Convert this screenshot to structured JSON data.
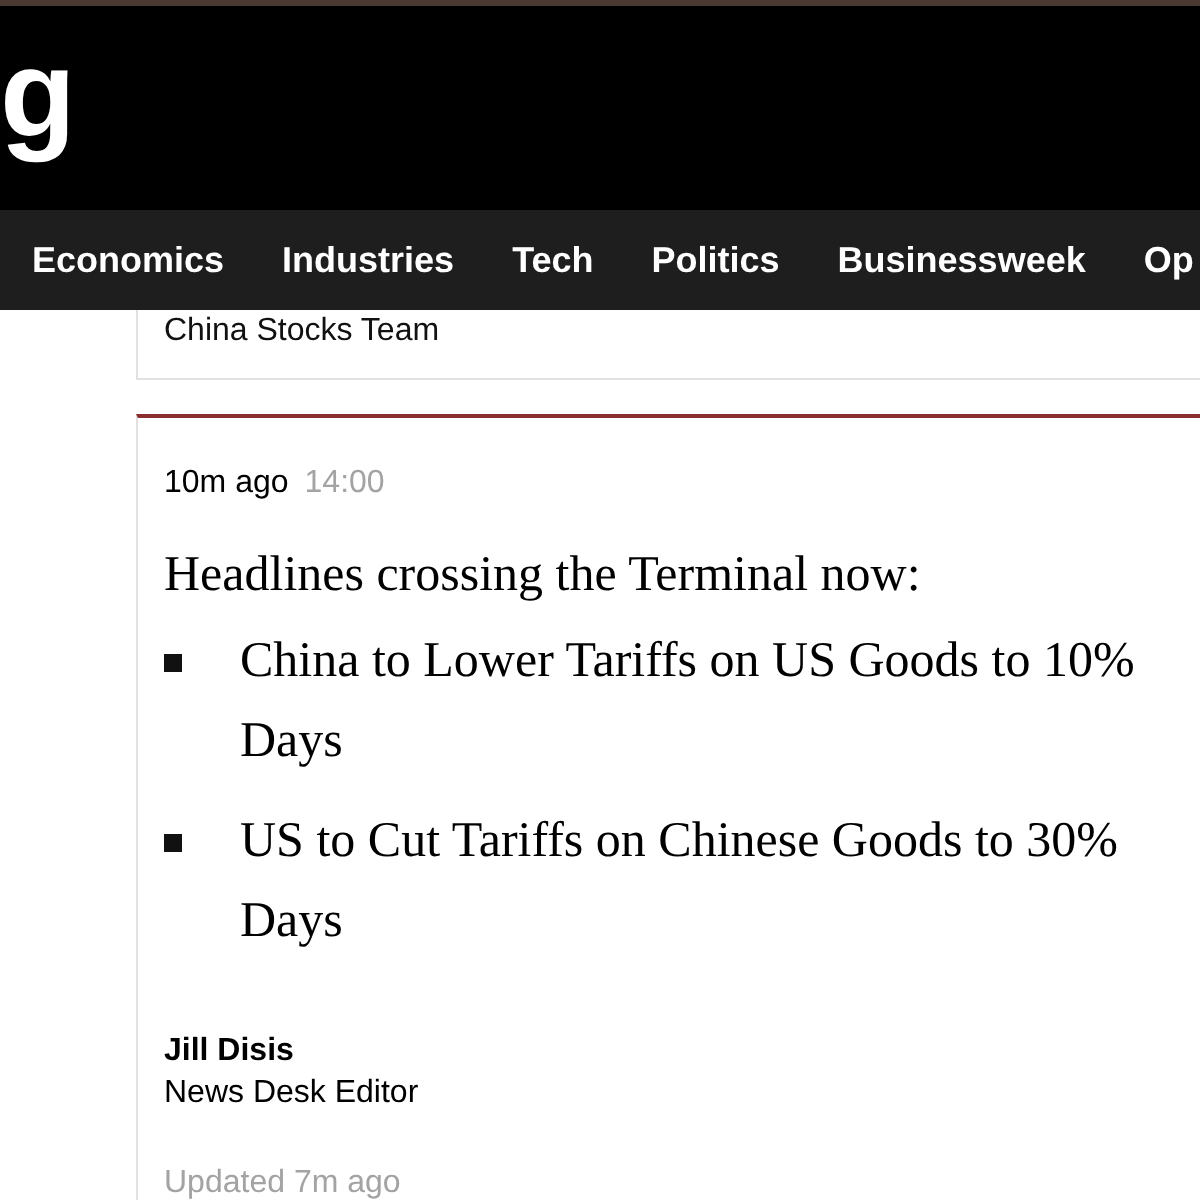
{
  "header": {
    "logo": "g"
  },
  "nav": {
    "items": [
      "Economics",
      "Industries",
      "Tech",
      "Politics",
      "Businessweek",
      "Op"
    ]
  },
  "previous_post": {
    "byline": "China Stocks Team"
  },
  "post": {
    "time_ago": "10m ago",
    "time": "14:00",
    "intro": "Headlines crossing the Terminal now:",
    "bullets": [
      {
        "lines": [
          "China to Lower Tariffs on US Goods to 10%",
          "Days"
        ]
      },
      {
        "lines": [
          "US to Cut Tariffs on Chinese Goods to 30%",
          "Days"
        ]
      }
    ],
    "author": {
      "name": "Jill Disis",
      "title": "News Desk Editor"
    },
    "updated": "Updated 7m ago"
  }
}
